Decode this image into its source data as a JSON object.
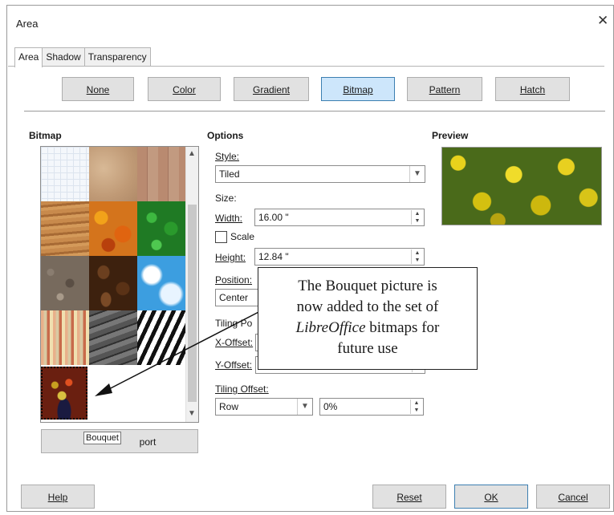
{
  "window": {
    "title": "Area",
    "close_glyph": "✕"
  },
  "tabs": [
    "Area",
    "Shadow",
    "Transparency"
  ],
  "fill_buttons": [
    {
      "label": "None"
    },
    {
      "label": "Color"
    },
    {
      "label": "Gradient"
    },
    {
      "label": "Bitmap",
      "selected": true
    },
    {
      "label": "Pattern"
    },
    {
      "label": "Hatch"
    }
  ],
  "bitmap": {
    "header": "Bitmap",
    "tooltip": "Bouquet",
    "import_label": "Import",
    "import_visible_text": "port"
  },
  "options": {
    "header": "Options",
    "style_label": "Style:",
    "style_value": "Tiled",
    "size_label": "Size:",
    "width_label": "Width:",
    "width_value": "16.00 \"",
    "scale_label": "Scale",
    "height_label": "Height:",
    "height_value": "12.84 \"",
    "position_label": "Position:",
    "position_value": "Center",
    "tiling_position_label": "Tiling Po",
    "xoffset_label": "X-Offset:",
    "yoffset_label": "Y-Offset:",
    "tiling_offset_label": "Tiling Offset:",
    "tiling_offset_mode": "Row",
    "tiling_offset_value": "0%"
  },
  "preview": {
    "header": "Preview"
  },
  "callout": {
    "line1": "The Bouquet picture is",
    "line2": "now added to the set of",
    "line3_em": "LibreOffice",
    "line3_rest": " bitmaps for",
    "line4": "future use"
  },
  "footer": {
    "help": "Help",
    "reset": "Reset",
    "ok": "OK",
    "cancel": "Cancel"
  },
  "colors": {
    "selected_button_bg": "#cde6fb",
    "selected_button_border": "#3c7fb1",
    "button_bg": "#e1e1e1"
  }
}
